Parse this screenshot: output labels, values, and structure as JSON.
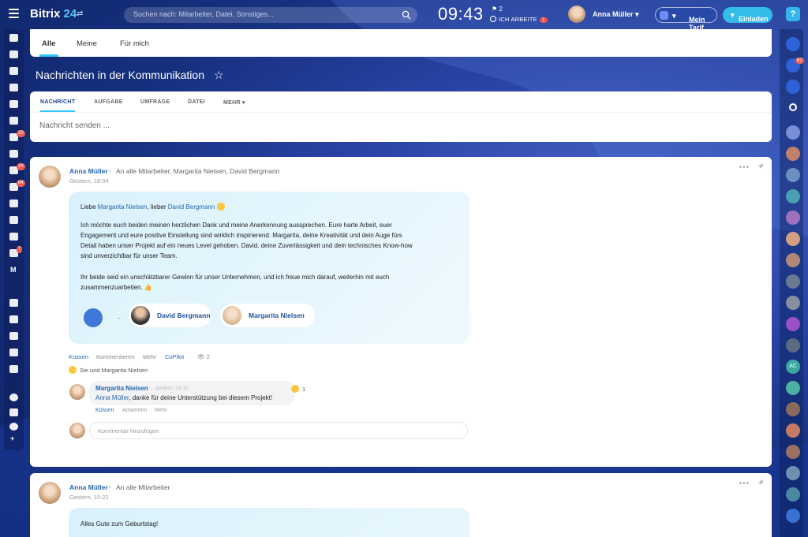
{
  "topbar": {
    "logo_main": "Bitrix",
    "logo_num": "24",
    "search_placeholder": "Suchen nach: Mitarbeiter, Datei, Sonstiges...",
    "clock": "09:43",
    "flag_count": "2",
    "work_status": "ICH ARBEITE",
    "work_count": "1",
    "user_name": "Anna Müller",
    "tarif_label": "Mein Tarif",
    "invite_label": "Einladen",
    "help_label": "?"
  },
  "sidebar": {
    "badges": [
      "22",
      "18",
      "64",
      "7"
    ],
    "m_label": "M"
  },
  "right_sidebar": {
    "notif_count": "62",
    "ac_label": "AC"
  },
  "tabs": [
    "Alle",
    "Meine",
    "Für mich"
  ],
  "page": {
    "title": "Nachrichten in der Kommunikation",
    "star": "☆"
  },
  "composer": {
    "tabs": [
      "NACHRICHT",
      "AUFGABE",
      "UMFRAGE",
      "DATEI",
      "MEHR"
    ],
    "placeholder": "Nachricht senden ..."
  },
  "post1": {
    "author": "Anna Müller",
    "arrow": "›",
    "destination": "An alle Mitarbeiter, Margarita Nielsen, David Bergmann",
    "time": "Gestern, 18:04",
    "greeting_pre": "Liebe ",
    "greeting_name1": "Margarita Nielsen",
    "greeting_mid": ", lieber ",
    "greeting_name2": "David Bergmann",
    "para1": "Ich möchte euch beiden meinen herzlichen Dank und meine Anerkennung aussprechen. Eure harte Arbeit, euer Engagement und eure positive Einstellung sind wirklich inspirierend. Margarita, deine Kreativität und dein Auge fürs Detail haben unser Projekt auf ein neues Level gehoben. David, deine Zuverlässigkeit und dein technisches Know-how sind unverzichtbar für unser Team.",
    "para2": "Ihr beide seid ein unschätzbarer Gewinn für unser Unternehmen, und ich freue mich darauf, weiterhin mit euch zusammenzuarbeiten. 👍",
    "kudo_arrow": "→",
    "kudo1": "David Bergmann",
    "kudo2": "Margarita Nielsen",
    "actions": {
      "like": "Küssen",
      "comment": "Kommentieren",
      "more": "Mehr",
      "copilot": "CoPilot",
      "views": "👁 2"
    },
    "reaction_text": "Sie und Margarita Nielsen",
    "comment": {
      "author": "Margarita Nielsen",
      "time": "gestern, 18:10",
      "mention": "Anna Müller",
      "text": ", danke für deine Unterstützung bei diesem Projekt!",
      "reaction_count": "1",
      "actions": {
        "like": "Küssen",
        "reply": "Antworten",
        "more": "Mehr"
      }
    },
    "comment_placeholder": "Kommentar hinzufügen"
  },
  "post2": {
    "author": "Anna Müller",
    "arrow": "›",
    "destination": "An alle Mitarbeiter",
    "time": "Gestern, 15:22",
    "text": "Alles Gute zum Geburtstag!"
  },
  "colors": {
    "accent": "#2fc6f6",
    "link": "#2467b0",
    "badge": "#f05a50"
  }
}
